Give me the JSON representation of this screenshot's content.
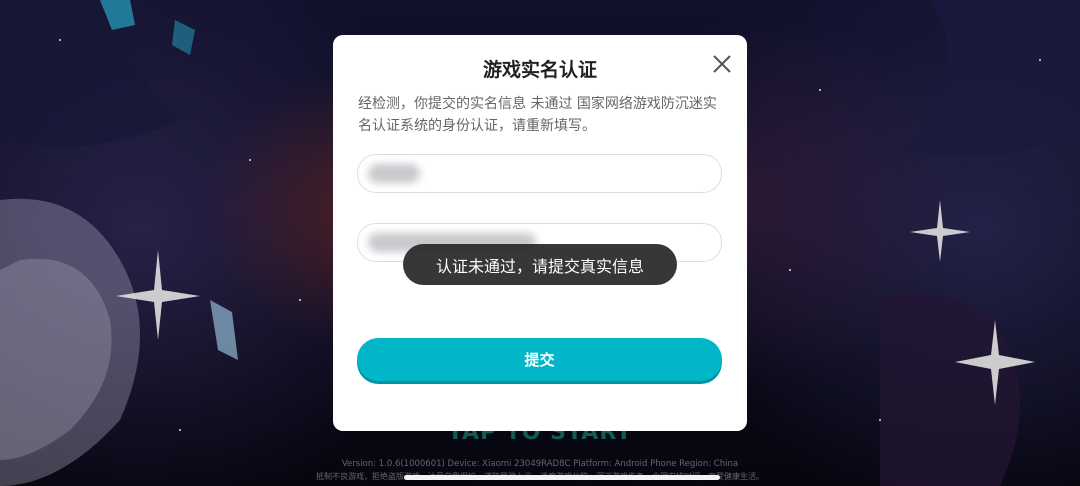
{
  "dialog": {
    "title": "游戏实名认证",
    "notice": "经检测，你提交的实名信息 未通过 国家网络游戏防沉迷实名认证系统的身份认证，请重新填写。",
    "name_field_value": "",
    "id_field_value": "",
    "submit_label": "提交"
  },
  "toast": {
    "message": "认证未通过，请提交真实信息"
  },
  "background": {
    "tap_to_start": "TAP TO START",
    "version_line": "Version: 1.0.6(1000601)   Device: Xiaomi 23049RAD8C   Platform: Android Phone   Region: China",
    "health_line": "抵制不良游戏，拒绝盗版游戏。注意自我保护，谨防受骗上当。适度游戏益脑，沉迷游戏伤身。合理安排时间，享受健康生活。"
  },
  "colors": {
    "accent": "#00b6c8",
    "toast_bg": "#282828",
    "dialog_bg": "#ffffff"
  },
  "icons": {
    "close": "close-icon"
  }
}
